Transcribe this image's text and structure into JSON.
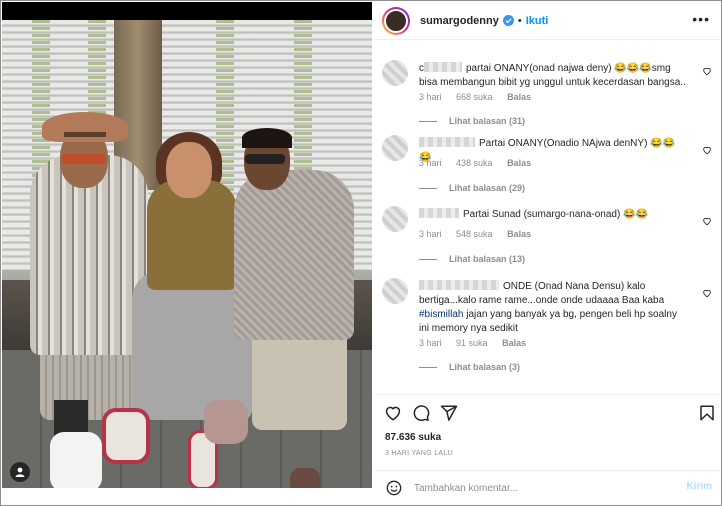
{
  "post": {
    "username": "sumargodenny",
    "follow_label": "Ikuti",
    "more_label": "•••",
    "likes": "87.636 suka",
    "timestamp": "3 HARI YANG LALU"
  },
  "comments": [
    {
      "name_redacted_prefix": "c",
      "text": "partai ONANY(onad najwa deny) 😂😂😂smg bisa membangun bibit yg unggul untuk kecerdasan bangsa..",
      "time": "3 hari",
      "likes": "668 suka",
      "reply_label": "Balas",
      "replies": "Lihat balasan (31)"
    },
    {
      "name_redacted_prefix": "",
      "text": "Partai ONANY(Onadio NAjwa denNY) 😂😂😂",
      "time": "3 hari",
      "likes": "438 suka",
      "reply_label": "Balas",
      "replies": "Lihat balasan (29)"
    },
    {
      "name_redacted_prefix": "",
      "text": "Partai Sunad (sumargo-nana-onad) 😂😂",
      "time": "3 hari",
      "likes": "548 suka",
      "reply_label": "Balas",
      "replies": "Lihat balasan (13)"
    },
    {
      "name_redacted_prefix": "",
      "text_before": "ONDE (Onad Nana Densu) kalo bertiga...kalo rame rame...onde onde udaaaa Baa kaba",
      "hashtag": "#bismillah",
      "text_after": " jajan yang banyak ya bg, pengen beli hp soalny ini memory nya sedikit",
      "time": "3 hari",
      "likes": "91 suka",
      "reply_label": "Balas",
      "replies": "Lihat balasan (3)"
    }
  ],
  "comment_box": {
    "placeholder": "Tambahkan komentar...",
    "post_label": "Kirim"
  },
  "colors": {
    "accent": "#0095f6",
    "post_disabled": "#b2dffc",
    "muted": "#8e8e8e",
    "hashtag": "#00376b"
  },
  "icons": [
    "tag-user-icon",
    "verified-badge-icon",
    "heart-icon",
    "comment-icon",
    "share-icon",
    "bookmark-icon",
    "emoji-icon",
    "more-options-icon"
  ]
}
